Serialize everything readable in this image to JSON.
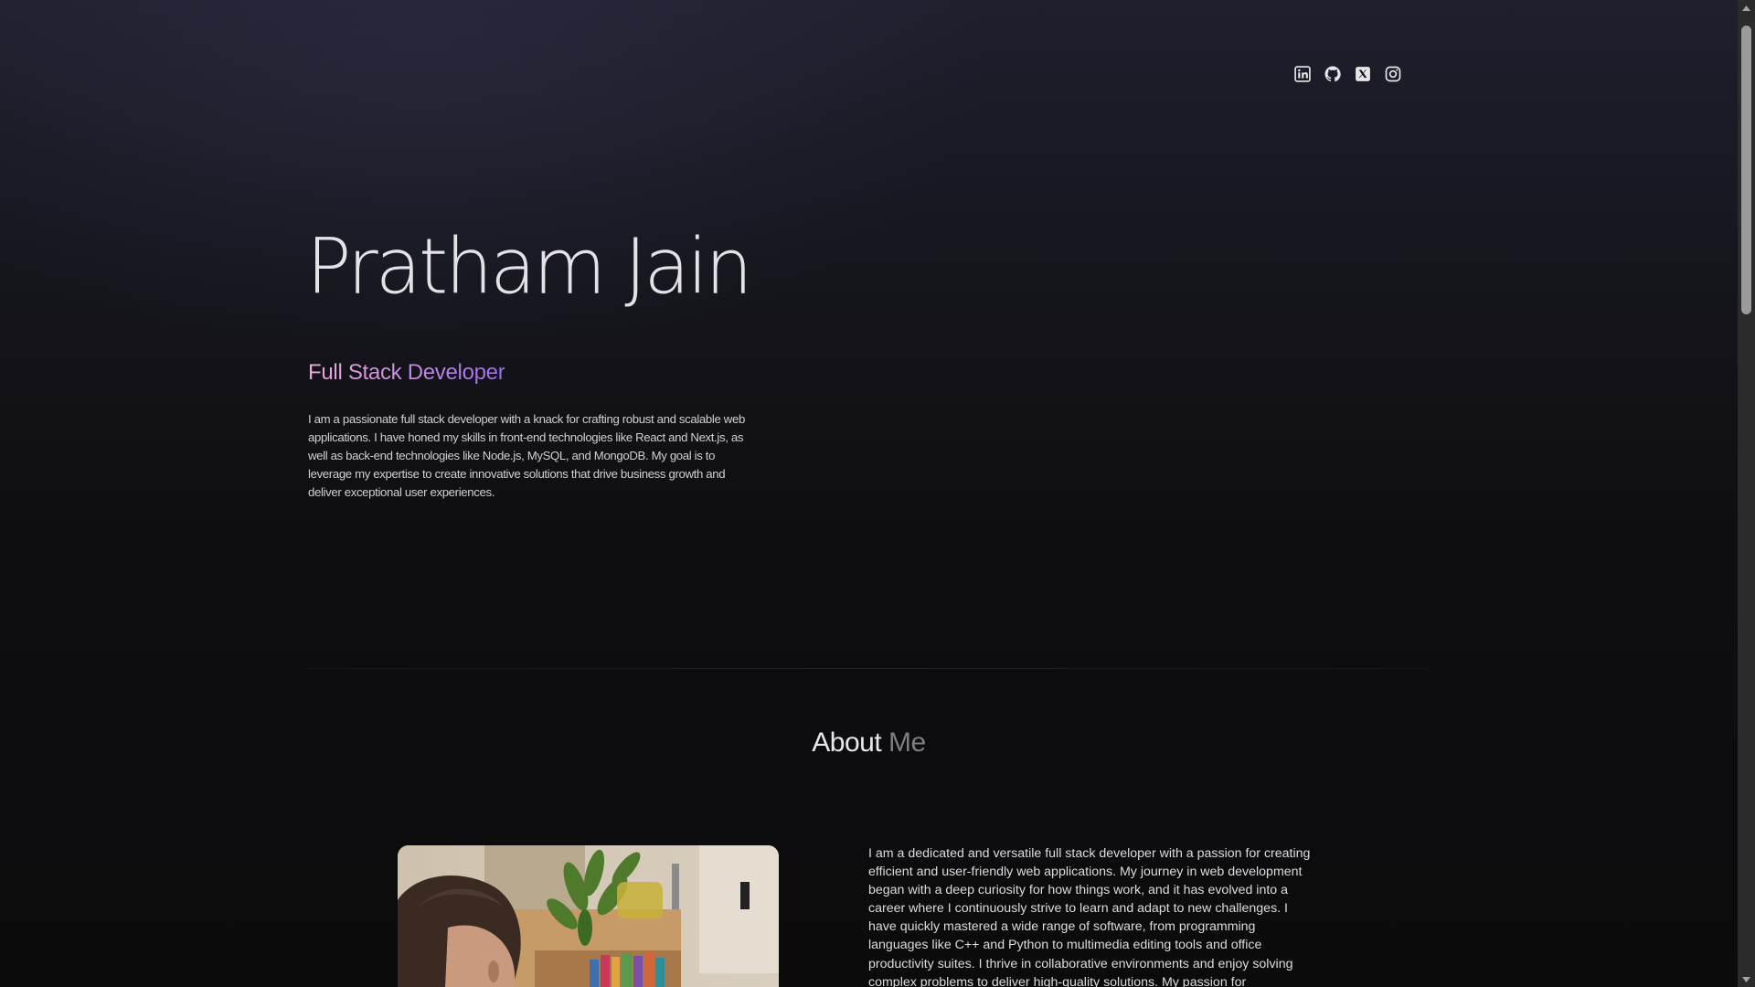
{
  "socials": [
    {
      "name": "linkedin",
      "icon": "linkedin-icon"
    },
    {
      "name": "github",
      "icon": "github-icon"
    },
    {
      "name": "x",
      "icon": "x-twitter-icon"
    },
    {
      "name": "instagram",
      "icon": "instagram-icon"
    }
  ],
  "hero": {
    "name": "Pratham Jain",
    "role": "Full Stack Developer",
    "description": "I am a passionate full stack developer with a knack for crafting robust and scalable web applications. I have honed my skills in front-end technologies like React and Next.js, as well as back-end technologies like Node.js, MySQL, and MongoDB. My goal is to leverage my expertise to create innovative solutions that drive business growth and deliver exceptional user experiences."
  },
  "about": {
    "title_main": "About",
    "title_muted": "Me",
    "text": "I am a dedicated and versatile full stack developer with a passion for creating efficient and user-friendly web applications. My journey in web development began with a deep curiosity for how things work, and it has evolved into a career where I continuously strive to learn and adapt to new challenges. I have quickly mastered a wide range of software, from programming languages like C++ and Python to multimedia editing tools and office productivity suites. I thrive in collaborative environments and enjoy solving complex problems to deliver high-quality solutions. My passion for"
  },
  "colors": {
    "role_gradient_start": "#f0a6d8",
    "role_gradient_end": "#9a6ee8",
    "background_top": "#1f1f2e",
    "background_bottom": "#0b0b0c"
  }
}
